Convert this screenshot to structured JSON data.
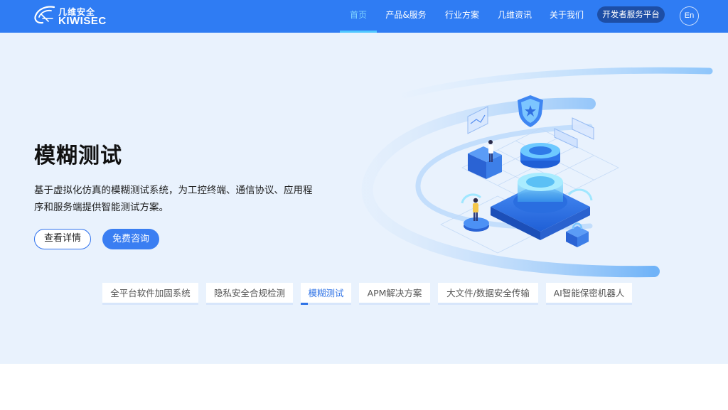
{
  "brand": {
    "name_cn": "几维安全",
    "name_en": "KIWISEC"
  },
  "colors": {
    "header_bg": "#2f7cf3",
    "hero_bg": "#e9f2fd",
    "accent": "#3a7ef2",
    "active_nav": "#7fd3ff"
  },
  "nav": {
    "items": [
      {
        "label": "首页",
        "active": true
      },
      {
        "label": "产品&服务"
      },
      {
        "label": "行业方案"
      },
      {
        "label": "几维资讯"
      },
      {
        "label": "关于我们"
      }
    ],
    "dev_platform": "开发者服务平台",
    "lang": "En"
  },
  "hero": {
    "title": "模糊测试",
    "description": "基于虚拟化仿真的模糊测试系统，为工控终端、通信协议、应用程序和服务端提供智能测试方案。",
    "btn_detail": "查看详情",
    "btn_consult": "免费咨询"
  },
  "tabs": [
    {
      "label": "全平台软件加固系统"
    },
    {
      "label": "隐私安全合规检测"
    },
    {
      "label": "模糊测试",
      "active": true
    },
    {
      "label": "APM解决方案"
    },
    {
      "label": "大文件/数据安全传输"
    },
    {
      "label": "AI智能保密机器人"
    }
  ]
}
